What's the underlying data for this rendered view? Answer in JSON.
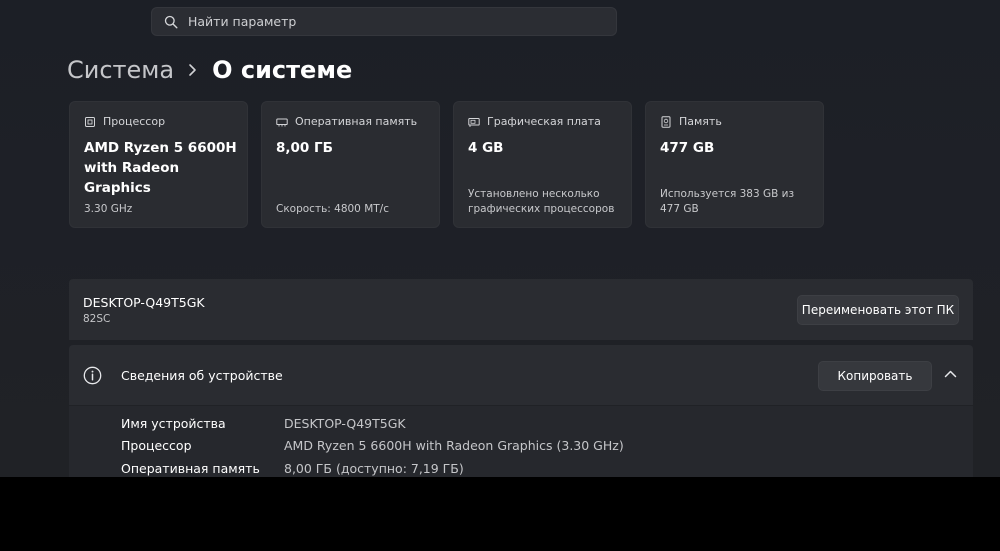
{
  "search": {
    "placeholder": "Найти параметр"
  },
  "breadcrumb": {
    "parent": "Система",
    "current": "О системе"
  },
  "cards": [
    {
      "icon": "cpu-icon",
      "label": "Процессор",
      "value": "AMD Ryzen 5 6600H with Radeon Graphics",
      "sub": "3.30 GHz"
    },
    {
      "icon": "ram-icon",
      "label": "Оперативная память",
      "value": "8,00 ГБ",
      "sub": "Скорость: 4800 МТ/с"
    },
    {
      "icon": "gpu-icon",
      "label": "Графическая плата",
      "value": "4 GB",
      "sub": "Установлено несколько графических процессоров"
    },
    {
      "icon": "storage-icon",
      "label": "Память",
      "value": "477 GB",
      "sub": "Используется 383 GB из 477 GB"
    }
  ],
  "pc": {
    "name": "DESKTOP-Q49T5GK",
    "model": "82SC",
    "rename_label": "Переименовать этот ПК"
  },
  "device_info": {
    "title": "Сведения об устройстве",
    "copy_label": "Копировать",
    "rows": [
      {
        "label": "Имя устройства",
        "value": "DESKTOP-Q49T5GK"
      },
      {
        "label": "Процессор",
        "value": "AMD Ryzen 5 6600H with Radeon Graphics (3.30 GHz)"
      },
      {
        "label": "Оперативная память",
        "value": "8,00 ГБ (доступно: 7,19 ГБ)"
      }
    ]
  }
}
